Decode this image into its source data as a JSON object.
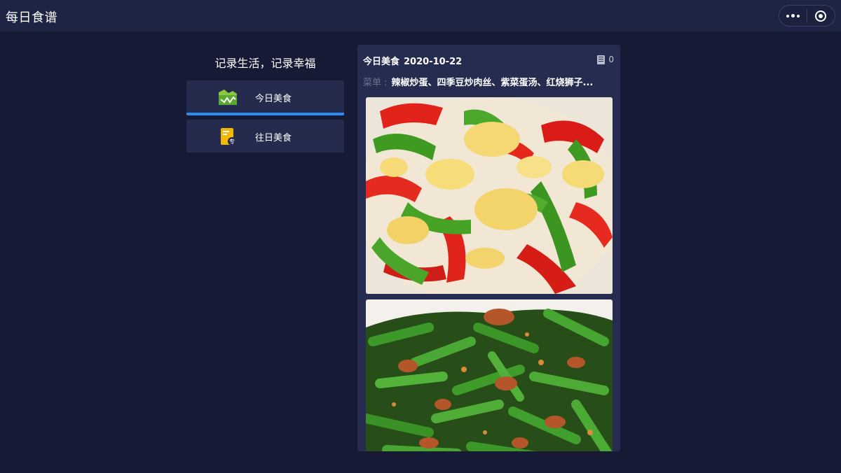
{
  "topbar": {
    "title": "每日食谱",
    "more_icon": "more-dots-icon",
    "close_icon": "target-circle-icon"
  },
  "sidebar": {
    "slogan": "记录生活，记录幸福",
    "items": [
      {
        "label": "今日美食",
        "icon": "mountain-chart-icon",
        "active": true
      },
      {
        "label": "往日美食",
        "icon": "document-tag-icon",
        "active": false
      }
    ],
    "active_color": "#2a8cf3"
  },
  "card": {
    "title": "今日美食",
    "date": "2020-10-22",
    "count": "0",
    "count_icon": "book-icon",
    "menu_label": "菜单 :",
    "menu_value": "辣椒炒蛋、四季豆炒肉丝、紫菜蛋汤、红烧狮子...",
    "photos": [
      {
        "name": "pepper-scrambled-eggs-photo"
      },
      {
        "name": "green-beans-pork-photo"
      }
    ]
  },
  "colors": {
    "background": "#161a35",
    "topbar": "#1e2444",
    "panel": "#252b4d",
    "card": "#262c4f"
  }
}
